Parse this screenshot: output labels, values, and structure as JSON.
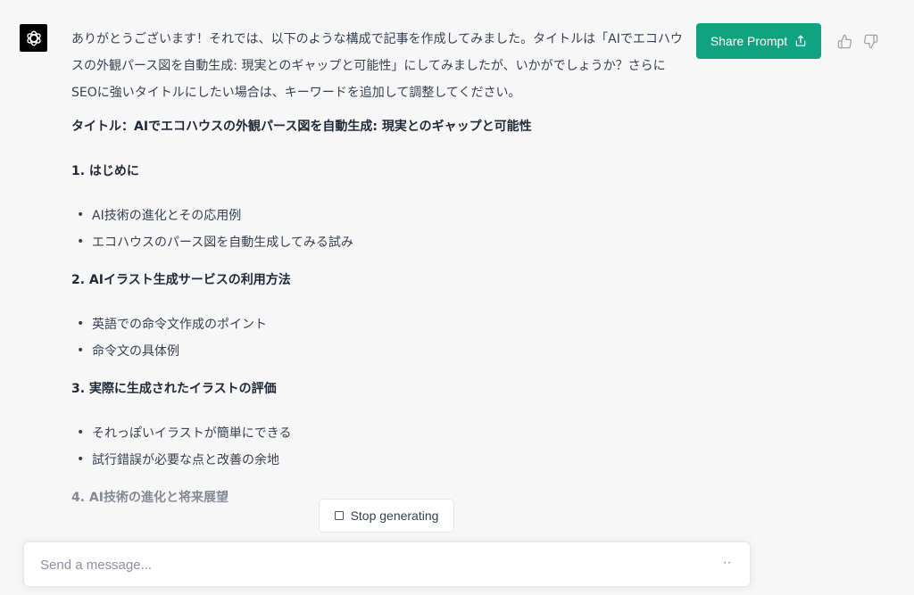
{
  "message": {
    "intro": "ありがとうございます！それでは、以下のような構成で記事を作成してみました。タイトルは「AIでエコハウスの外観パース図を自動生成: 現実とのギャップと可能性」にしてみましたが、いかがでしょうか？さらにSEOに強いタイトルにしたい場合は、キーワードを追加して調整してください。",
    "title": "タイトル：AIでエコハウスの外観パース図を自動生成: 現実とのギャップと可能性",
    "sections": [
      {
        "heading": "1. はじめに",
        "bullets": [
          "AI技術の進化とその応用例",
          "エコハウスのパース図を自動生成してみる試み"
        ]
      },
      {
        "heading": "2. AIイラスト生成サービスの利用方法",
        "bullets": [
          "英語での命令文作成のポイント",
          "命令文の具体例"
        ]
      },
      {
        "heading": "3. 実際に生成されたイラストの評価",
        "bullets": [
          "それっぽいイラストが簡単にできる",
          "試行錯誤が必要な点と改善の余地"
        ]
      }
    ],
    "partial_heading": "4. AI技術の進化と将来展望"
  },
  "header": {
    "share_label": "Share Prompt",
    "share_icon": "share-icon",
    "thumbs_up_icon": "thumbs-up-icon",
    "thumbs_down_icon": "thumbs-down-icon",
    "avatar_icon": "openai-logo-icon"
  },
  "controls": {
    "stop_label": "Stop generating"
  },
  "composer": {
    "placeholder": "Send a message...",
    "typing_indicator": "··"
  },
  "colors": {
    "accent": "#10a37f",
    "background": "#f7f7f8",
    "text": "#374151"
  }
}
